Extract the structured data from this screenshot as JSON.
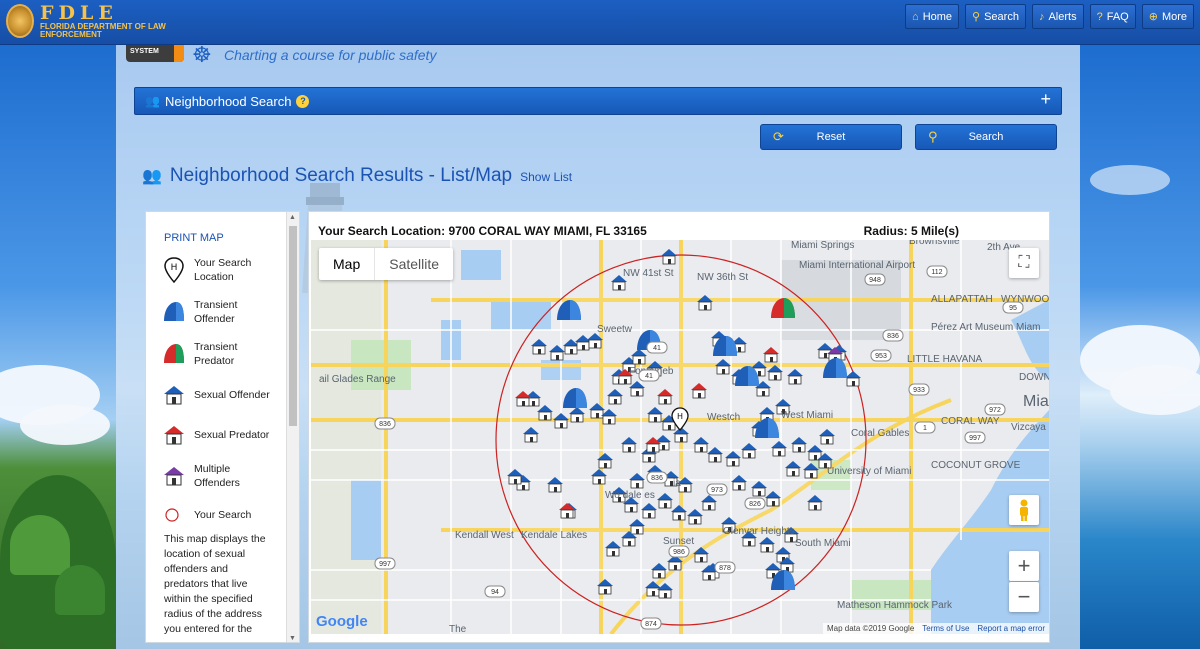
{
  "header": {
    "logo_title": "FDLE",
    "logo_subtitle": "FLORIDA DEPARTMENT OF LAW ENFORCEMENT",
    "nav": [
      {
        "label": "Home",
        "icon": "home-icon"
      },
      {
        "label": "Search",
        "icon": "search-icon"
      },
      {
        "label": "Alerts",
        "icon": "bell-icon"
      },
      {
        "label": "FAQ",
        "icon": "question-icon"
      },
      {
        "label": "More",
        "icon": "plus-circle-icon"
      }
    ]
  },
  "banner": {
    "system_tag": "SYSTEM",
    "tagline": "Charting a course for public safety"
  },
  "search_panel": {
    "title": "Neighborhood Search",
    "reset_label": "Reset",
    "search_label": "Search"
  },
  "results": {
    "title": "Neighborhood Search Results - List/Map",
    "show_list": "Show List"
  },
  "legend": {
    "print_map": "PRINT MAP",
    "items": [
      {
        "label": "Your Search Location",
        "icon": "search-location-pin-icon"
      },
      {
        "label": "Transient Offender",
        "icon": "transient-offender-tent-icon"
      },
      {
        "label": "Transient Predator",
        "icon": "transient-predator-tent-icon"
      },
      {
        "label": "Sexual Offender",
        "icon": "sexual-offender-house-icon"
      },
      {
        "label": "Sexual Predator",
        "icon": "sexual-predator-house-icon"
      },
      {
        "label": "Multiple Offenders",
        "icon": "multiple-offenders-house-icon"
      },
      {
        "label": "Your Search",
        "icon": "search-radius-circle-icon"
      }
    ],
    "description": "This map displays the location of sexual offenders and predators that live within the specified radius of the address you entered for the"
  },
  "map": {
    "search_location_label": "Your Search Location: 9700 CORAL WAY MIAMI, FL 33165",
    "radius_label": "Radius: 5 Mile(s)",
    "map_type_map": "Map",
    "map_type_satellite": "Satellite",
    "google": "Google",
    "attribution": "Map data ©2019 Google",
    "terms": "Terms of Use",
    "report": "Report a map error",
    "places": [
      "Miami Springs",
      "Miami International Airport",
      "Pérez Art Museum Miam",
      "LITTLE HAVANA",
      "ALLAPATTAH",
      "WYNWOOD",
      "Mia",
      "Sweetw",
      "Fontaineb",
      "Westch",
      "West Miami",
      "Coral Gables",
      "CORAL WAY",
      "Vizcaya & Garde",
      "COCONUT GROVE",
      "University of Miami",
      "ail Glades Range",
      "Kendall West",
      "Kendale Lakes",
      "Sunset",
      "Glenvar Heights",
      "South Miami",
      "Matheson Hammock Park",
      "NW 41st St",
      "NW 36th St",
      "Brownsville",
      "DOWN MIA",
      "Wo dale es",
      "ia",
      "The",
      "2th Ave"
    ],
    "road_shields": [
      "112",
      "948",
      "95",
      "836",
      "953",
      "41",
      "933",
      "972",
      "1",
      "997",
      "836",
      "41",
      "836",
      "973",
      "826",
      "986",
      "878",
      "94",
      "874",
      "94",
      "997"
    ]
  },
  "colors": {
    "brand_blue": "#1758b7",
    "accent_yellow": "#ffd23c",
    "offender_blue": "#1f5fb8",
    "predator_red": "#d52b2b",
    "multiple_purple": "#7a3aa8",
    "radius_red": "#cc2222"
  }
}
